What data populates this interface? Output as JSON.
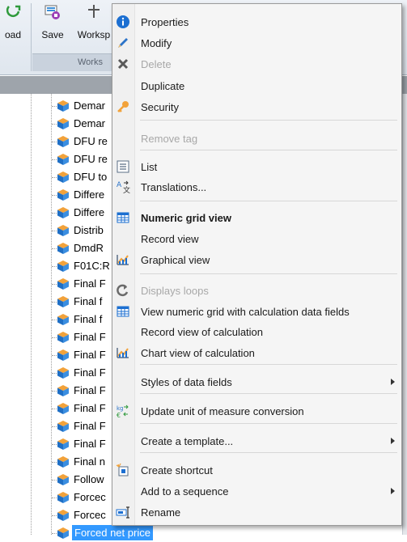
{
  "ribbon": {
    "buttons": [
      {
        "label": "oad",
        "icon": "download-icon"
      },
      {
        "label": "Save",
        "icon": "save-icon"
      },
      {
        "label": "Worksp",
        "icon": "workspace-icon"
      }
    ],
    "group_label": "Works"
  },
  "tree": {
    "items": [
      "Demar",
      "Demar",
      "DFU re",
      "DFU re",
      "DFU to",
      "Differe",
      "Differe",
      "Distrib",
      "DmdR",
      "F01C:R",
      "Final F",
      "Final f",
      "Final f",
      "Final F",
      "Final F",
      "Final F",
      "Final F",
      "Final F",
      "Final F",
      "Final F",
      "Final n",
      "Follow",
      "Forcec",
      "Forcec"
    ],
    "selected_item": "Forced net price",
    "item_icon": "cube-icon"
  },
  "menu": {
    "items": [
      {
        "label": "Properties",
        "icon": "info-icon",
        "disabled": false,
        "bold": false,
        "submenu": false
      },
      {
        "label": "Modify",
        "icon": "pencil-icon",
        "disabled": false,
        "bold": false,
        "submenu": false
      },
      {
        "label": "Delete",
        "icon": "x-icon",
        "disabled": true,
        "bold": false,
        "submenu": false
      },
      {
        "label": "Duplicate",
        "icon": "",
        "disabled": false,
        "bold": false,
        "submenu": false
      },
      {
        "label": "Security",
        "icon": "key-icon",
        "disabled": false,
        "bold": false,
        "submenu": false
      },
      {
        "label": "Remove tag",
        "icon": "",
        "disabled": true,
        "bold": false,
        "submenu": false
      },
      {
        "label": "List",
        "icon": "list-icon",
        "disabled": false,
        "bold": false,
        "submenu": false
      },
      {
        "label": "Translations...",
        "icon": "translate-icon",
        "disabled": false,
        "bold": false,
        "submenu": false
      },
      {
        "label": "Numeric grid view",
        "icon": "grid-icon",
        "disabled": false,
        "bold": true,
        "submenu": false
      },
      {
        "label": "Record view",
        "icon": "",
        "disabled": false,
        "bold": false,
        "submenu": false
      },
      {
        "label": "Graphical view",
        "icon": "chart-icon",
        "disabled": false,
        "bold": false,
        "submenu": false
      },
      {
        "label": "Displays loops",
        "icon": "loop-icon",
        "disabled": true,
        "bold": false,
        "submenu": false
      },
      {
        "label": "View numeric grid with calculation data fields",
        "icon": "grid-icon",
        "disabled": false,
        "bold": false,
        "submenu": false
      },
      {
        "label": "Record view of calculation",
        "icon": "",
        "disabled": false,
        "bold": false,
        "submenu": false
      },
      {
        "label": "Chart view of calculation",
        "icon": "chart-icon",
        "disabled": false,
        "bold": false,
        "submenu": false
      },
      {
        "label": "Styles of data fields",
        "icon": "",
        "disabled": false,
        "bold": false,
        "submenu": true
      },
      {
        "label": "Update unit of measure conversion",
        "icon": "unit-conversion-icon",
        "disabled": false,
        "bold": false,
        "submenu": false
      },
      {
        "label": "Create a template...",
        "icon": "",
        "disabled": false,
        "bold": false,
        "submenu": true
      },
      {
        "label": "Create shortcut",
        "icon": "shortcut-icon",
        "disabled": false,
        "bold": false,
        "submenu": false
      },
      {
        "label": "Add to a sequence",
        "icon": "",
        "disabled": false,
        "bold": false,
        "submenu": true
      },
      {
        "label": "Rename",
        "icon": "rename-icon",
        "disabled": false,
        "bold": false,
        "submenu": false
      }
    ]
  },
  "colors": {
    "selection": "#3399ff",
    "disabled_text": "#a8a8a8",
    "cube_orange": "#f2a23a",
    "cube_blue": "#1f6fc5"
  }
}
